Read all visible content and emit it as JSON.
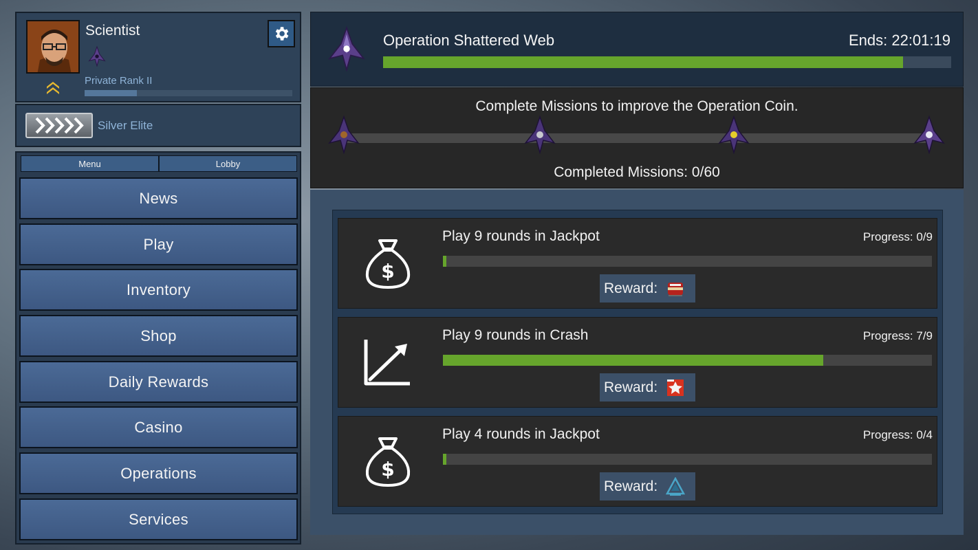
{
  "profile": {
    "name": "Scientist",
    "rank": "Private Rank II",
    "xp_fraction": 0.25,
    "skill_group": "Silver Elite"
  },
  "menu": {
    "tabs": [
      "Menu",
      "Lobby"
    ],
    "items": [
      "News",
      "Play",
      "Inventory",
      "Shop",
      "Daily Rewards",
      "Casino",
      "Operations",
      "Services"
    ]
  },
  "operation": {
    "title": "Operation Shattered Web",
    "ends": "Ends: 22:01:19",
    "progress_fraction": 0.915
  },
  "coin": {
    "instruction": "Complete Missions to improve the Operation Coin.",
    "completed": "Completed Missions: 0/60"
  },
  "missions": [
    {
      "title": "Play 9 rounds in Jackpot",
      "progress": "Progress: 0/9",
      "fraction": 0.007,
      "icon": "money-bag-icon",
      "reward_label": "Reward:"
    },
    {
      "title": "Play 9 rounds in Crash",
      "progress": "Progress: 7/9",
      "fraction": 0.778,
      "icon": "chart-up-icon",
      "reward_label": "Reward:"
    },
    {
      "title": "Play 4 rounds in Jackpot",
      "progress": "Progress: 0/4",
      "fraction": 0.007,
      "icon": "money-bag-icon",
      "reward_label": "Reward:"
    }
  ],
  "colors": {
    "accent_green": "#66a52c",
    "button_blue": "#4b6a96",
    "coin_purple": "#5a3f8a"
  }
}
